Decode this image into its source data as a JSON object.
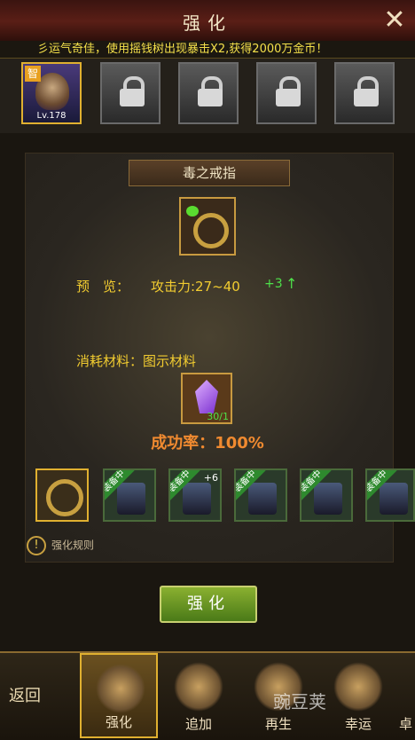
{
  "header": {
    "title": "强化",
    "close_symbol": "✕"
  },
  "ticker": {
    "text": "彡运气奇佳，使用摇钱树出现暴击X2,获得2000万金币！"
  },
  "heroes": [
    {
      "type": "hero",
      "badge": "智",
      "level": "Lv.178",
      "selected": true
    },
    {
      "type": "locked"
    },
    {
      "type": "locked"
    },
    {
      "type": "locked"
    },
    {
      "type": "locked"
    }
  ],
  "item": {
    "name": "毒之戒指"
  },
  "preview": {
    "label": "预　览：",
    "stat": "攻击力:27~40",
    "bonus": "+3",
    "arrow": "↑"
  },
  "material": {
    "label": "消耗材料：图示材料",
    "count": "30/1"
  },
  "success": {
    "text": "成功率：100%"
  },
  "equipment": [
    {
      "tag": "",
      "selected": true
    },
    {
      "tag": "装备中",
      "selected": false
    },
    {
      "tag": "装备中",
      "plus": "+6",
      "selected": false
    },
    {
      "tag": "装备中",
      "selected": false
    },
    {
      "tag": "装备中",
      "selected": false
    },
    {
      "tag": "装备中",
      "selected": false
    }
  ],
  "rules": {
    "icon": "!",
    "text": "强化规则"
  },
  "button": {
    "label": "强化"
  },
  "bottom": {
    "back": "返回",
    "tabs": [
      {
        "label": "强化",
        "active": true
      },
      {
        "label": "追加",
        "active": false
      },
      {
        "label": "再生",
        "active": false
      },
      {
        "label": "幸运",
        "active": false
      },
      {
        "label": "卓",
        "active": false
      }
    ],
    "watermark": "豌豆荚"
  }
}
